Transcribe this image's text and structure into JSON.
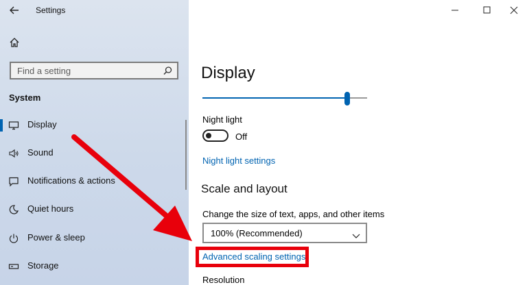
{
  "window": {
    "title": "Settings"
  },
  "sidebar": {
    "search_placeholder": "Find a setting",
    "section_title": "System",
    "items": [
      {
        "label": "Display",
        "icon": "monitor-icon"
      },
      {
        "label": "Sound",
        "icon": "speaker-icon"
      },
      {
        "label": "Notifications & actions",
        "icon": "message-icon"
      },
      {
        "label": "Quiet hours",
        "icon": "moon-icon"
      },
      {
        "label": "Power & sleep",
        "icon": "power-icon"
      },
      {
        "label": "Storage",
        "icon": "storage-icon"
      }
    ]
  },
  "main": {
    "page_title": "Display",
    "brightness_level": 0.88,
    "night_light": {
      "label": "Night light",
      "state_label": "Off",
      "settings_link": "Night light settings"
    },
    "scale_section": {
      "title": "Scale and layout",
      "size_label": "Change the size of text, apps, and other items",
      "selected_value": "100% (Recommended)",
      "advanced_link": "Advanced scaling settings"
    },
    "resolution_label": "Resolution"
  },
  "annotation": {
    "color": "#e8000b"
  },
  "colors": {
    "accent": "#0063b1",
    "sidebar_bg": "#cdd9ea"
  }
}
